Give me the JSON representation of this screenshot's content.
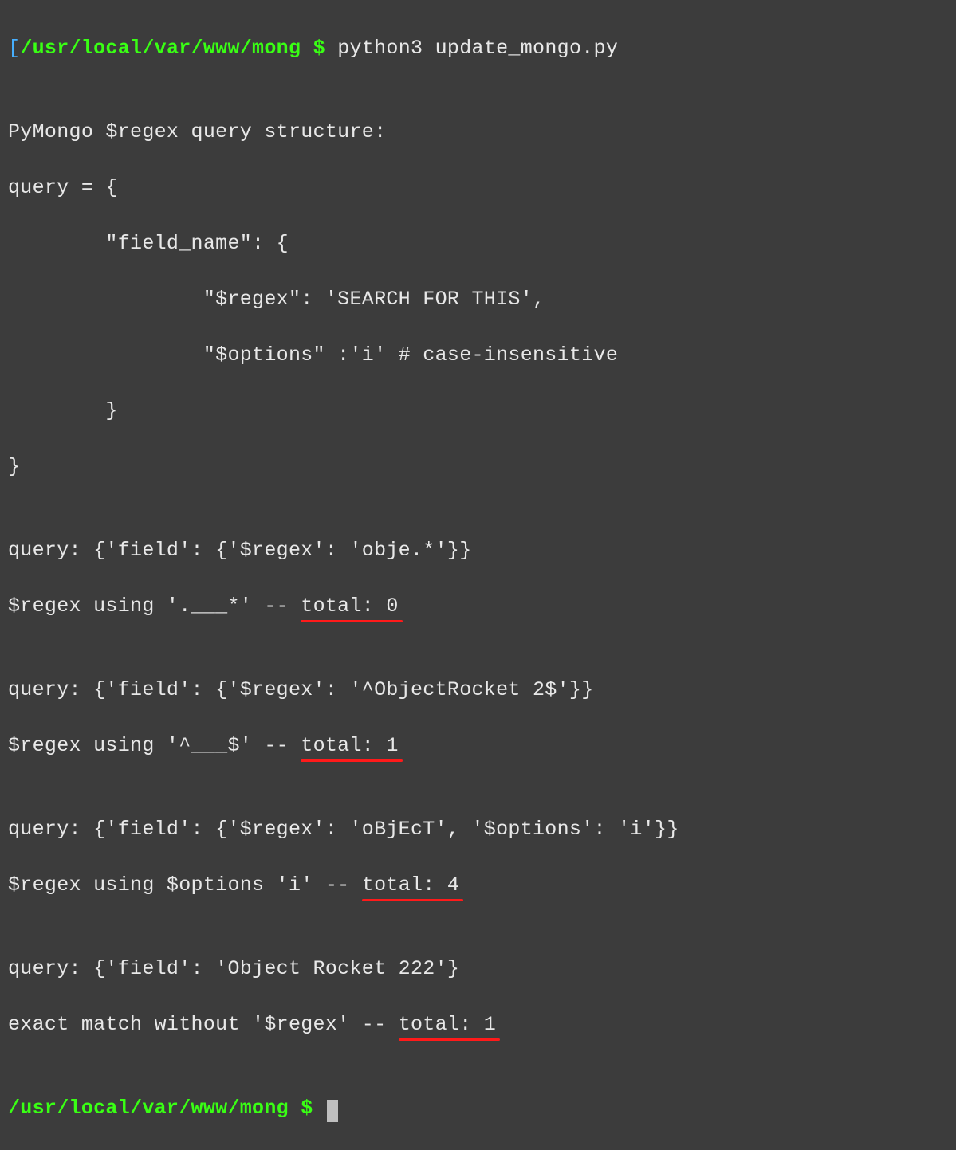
{
  "prompt": {
    "bracket": "[",
    "path": "/usr/local/var/www/mong",
    "symbol": " $ "
  },
  "command": "python3 update_mongo.py",
  "output": {
    "blank1": "",
    "struct0": "PyMongo $regex query structure:",
    "struct1": "query = {",
    "struct2": "        \"field_name\": {",
    "struct3": "                \"$regex\": 'SEARCH FOR THIS',",
    "struct4": "                \"$options\" :'i' # case-insensitive",
    "struct5": "        }",
    "struct6": "}",
    "blank2": "",
    "q1a": "query: {'field': {'$regex': 'obje.*'}}",
    "q1b_pre": "$regex using '.___*' -- ",
    "q1b_tot": "total: 0",
    "blank3": "",
    "q2a": "query: {'field': {'$regex': '^ObjectRocket 2$'}}",
    "q2b_pre": "$regex using '^___$' -- ",
    "q2b_tot": "total: 1",
    "blank4": "",
    "q3a": "query: {'field': {'$regex': 'oBjEcT', '$options': 'i'}}",
    "q3b_pre": "$regex using $options 'i' -- ",
    "q3b_tot": "total: 4",
    "blank5": "",
    "q4a": "query: {'field': 'Object Rocket 222'}",
    "q4b_pre": "exact match without '$regex' -- ",
    "q4b_tot": "total: 1",
    "blank6": ""
  }
}
